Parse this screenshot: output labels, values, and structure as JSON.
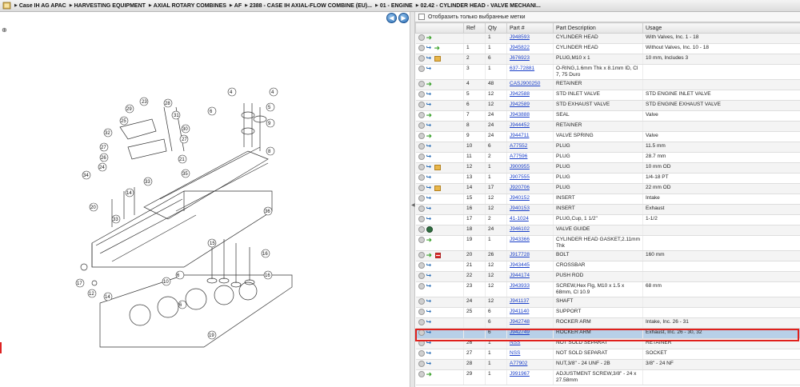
{
  "breadcrumb": [
    "Case IH AG APAC",
    "HARVESTING EQUIPMENT",
    "AXIAL ROTARY COMBINES",
    "AF",
    "2388 - CASE IH AXIAL-FLOW COMBINE (EU)...",
    "01 - ENGINE",
    "02.42 - CYLINDER HEAD - VALVE MECHANI..."
  ],
  "nav": {
    "back": "◀",
    "forward": "▶"
  },
  "filter": {
    "label": "Отобразить только выбранные метки"
  },
  "columns": [
    "Ref",
    "Qty",
    "Part #",
    "Part Description",
    "Usage"
  ],
  "diagram_labels": [
    "1",
    "2",
    "3",
    "4",
    "5",
    "6",
    "7",
    "8",
    "9",
    "10",
    "11",
    "12",
    "13",
    "14",
    "15",
    "16",
    "17",
    "19",
    "20",
    "21",
    "22",
    "23",
    "24",
    "25",
    "26",
    "27",
    "28",
    "29",
    "30",
    "31",
    "32",
    "33",
    "34",
    "35",
    "36"
  ],
  "rows": [
    {
      "ref": "",
      "qty": "1",
      "part": "J948593",
      "desc": "CYLINDER HEAD",
      "usage": "With Valves, Inc. 1 - 18",
      "icons": [
        "green"
      ]
    },
    {
      "ref": "1",
      "qty": "1",
      "part": "J945822",
      "desc": "CYLINDER HEAD",
      "usage": "Without Valves, Inc. 10 - 18",
      "icons": [
        "link",
        "green"
      ]
    },
    {
      "ref": "2",
      "qty": "6",
      "part": "J676923",
      "desc": "PLUG,M10 x 1",
      "usage": "10 mm, Includes 3",
      "icons": [
        "link",
        "box"
      ]
    },
    {
      "ref": "3",
      "qty": "1",
      "part": "637-72881",
      "desc": "O-RING,1.6mm Thk x 8.1mm ID, Cl 7, 75 Duro",
      "usage": "",
      "icons": [
        "link"
      ]
    },
    {
      "ref": "4",
      "qty": "48",
      "part": "CASJ900250",
      "desc": "RETAINER",
      "usage": "",
      "icons": [
        "green"
      ]
    },
    {
      "ref": "5",
      "qty": "12",
      "part": "J942588",
      "desc": "STD INLET VALVE",
      "usage": "STD ENGINE INLET VALVE",
      "icons": [
        "link"
      ]
    },
    {
      "ref": "6",
      "qty": "12",
      "part": "J942589",
      "desc": "STD EXHAUST VALVE",
      "usage": "STD ENGINE EXHAUST VALVE",
      "icons": [
        "link"
      ]
    },
    {
      "ref": "7",
      "qty": "24",
      "part": "J943888",
      "desc": "SEAL",
      "usage": "Valve",
      "icons": [
        "green"
      ]
    },
    {
      "ref": "8",
      "qty": "24",
      "part": "J944452",
      "desc": "RETAINER",
      "usage": "",
      "icons": [
        "link"
      ]
    },
    {
      "ref": "9",
      "qty": "24",
      "part": "J944711",
      "desc": "VALVE SPRING",
      "usage": "Valve",
      "icons": [
        "green"
      ]
    },
    {
      "ref": "10",
      "qty": "6",
      "part": "A77552",
      "desc": "PLUG",
      "usage": "11.5 mm",
      "icons": [
        "link"
      ]
    },
    {
      "ref": "11",
      "qty": "2",
      "part": "A77596",
      "desc": "PLUG",
      "usage": "28.7 mm",
      "icons": [
        "link"
      ]
    },
    {
      "ref": "12",
      "qty": "1",
      "part": "J900955",
      "desc": "PLUG",
      "usage": "10 mm OD",
      "icons": [
        "link",
        "box"
      ]
    },
    {
      "ref": "13",
      "qty": "1",
      "part": "J907555",
      "desc": "PLUG",
      "usage": "1/4-18 PT",
      "icons": [
        "link"
      ]
    },
    {
      "ref": "14",
      "qty": "17",
      "part": "J920706",
      "desc": "PLUG",
      "usage": "22 mm OD",
      "icons": [
        "link",
        "box"
      ]
    },
    {
      "ref": "15",
      "qty": "12",
      "part": "J940152",
      "desc": "INSERT",
      "usage": "Intake",
      "icons": [
        "link"
      ]
    },
    {
      "ref": "16",
      "qty": "12",
      "part": "J940153",
      "desc": "INSERT",
      "usage": "Exhaust",
      "icons": [
        "link"
      ]
    },
    {
      "ref": "17",
      "qty": "2",
      "part": "41-1024",
      "desc": "PLUG,Cup, 1 1/2\"",
      "usage": "1-1/2",
      "icons": [
        "link"
      ]
    },
    {
      "ref": "18",
      "qty": "24",
      "part": "J946102",
      "desc": "VALVE GUIDE",
      "usage": "",
      "icons": [
        "gear"
      ]
    },
    {
      "ref": "19",
      "qty": "1",
      "part": "J943366",
      "desc": "CYLINDER HEAD GASKET,2.11mm Thk",
      "usage": "",
      "icons": [
        "green"
      ]
    },
    {
      "ref": "20",
      "qty": "26",
      "part": "J917728",
      "desc": "BOLT",
      "usage": "160 mm",
      "icons": [
        "green",
        "flag"
      ]
    },
    {
      "ref": "21",
      "qty": "12",
      "part": "J943445",
      "desc": "CROSSBAR",
      "usage": "",
      "icons": [
        "link"
      ]
    },
    {
      "ref": "22",
      "qty": "12",
      "part": "J944174",
      "desc": "PUSH ROD",
      "usage": "",
      "icons": [
        "link"
      ]
    },
    {
      "ref": "23",
      "qty": "12",
      "part": "J943933",
      "desc": "SCREW,Hex Flg, M10 x 1.5 x 68mm, Cl 10.9",
      "usage": "68 mm",
      "icons": [
        "link"
      ]
    },
    {
      "ref": "24",
      "qty": "12",
      "part": "J941137",
      "desc": "SHAFT",
      "usage": "",
      "icons": [
        "link"
      ]
    },
    {
      "ref": "25",
      "qty": "6",
      "part": "J941140",
      "desc": "SUPPORT",
      "usage": "",
      "icons": [
        "link"
      ]
    },
    {
      "ref": "",
      "qty": "6",
      "part": "J942748",
      "desc": "ROCKER ARM",
      "usage": "Intake, Inc. 26 - 31",
      "icons": [
        "link"
      ]
    },
    {
      "ref": "",
      "qty": "6",
      "part": "J942749",
      "desc": "ROCKER ARM",
      "usage": "Exhaust, Inc. 26 - 30, 32",
      "icons": [
        "link"
      ],
      "selected": true
    },
    {
      "ref": "26",
      "qty": "1",
      "part": "NSS",
      "desc": "NOT SOLD SEPARAT",
      "usage": "RETAINER",
      "icons": [
        "link"
      ]
    },
    {
      "ref": "27",
      "qty": "1",
      "part": "NSS",
      "desc": "NOT SOLD SEPARAT",
      "usage": "SOCKET",
      "icons": [
        "link"
      ]
    },
    {
      "ref": "28",
      "qty": "1",
      "part": "A77902",
      "desc": "NUT,3/8\" - 24 UNF - 2B",
      "usage": "3/8\" - 24 NF",
      "icons": [
        "link"
      ]
    },
    {
      "ref": "29",
      "qty": "1",
      "part": "J991967",
      "desc": "ADJUSTMENT SCREW,3/8\" - 24 x 27.58mm",
      "usage": "",
      "icons": [
        "green"
      ]
    }
  ]
}
